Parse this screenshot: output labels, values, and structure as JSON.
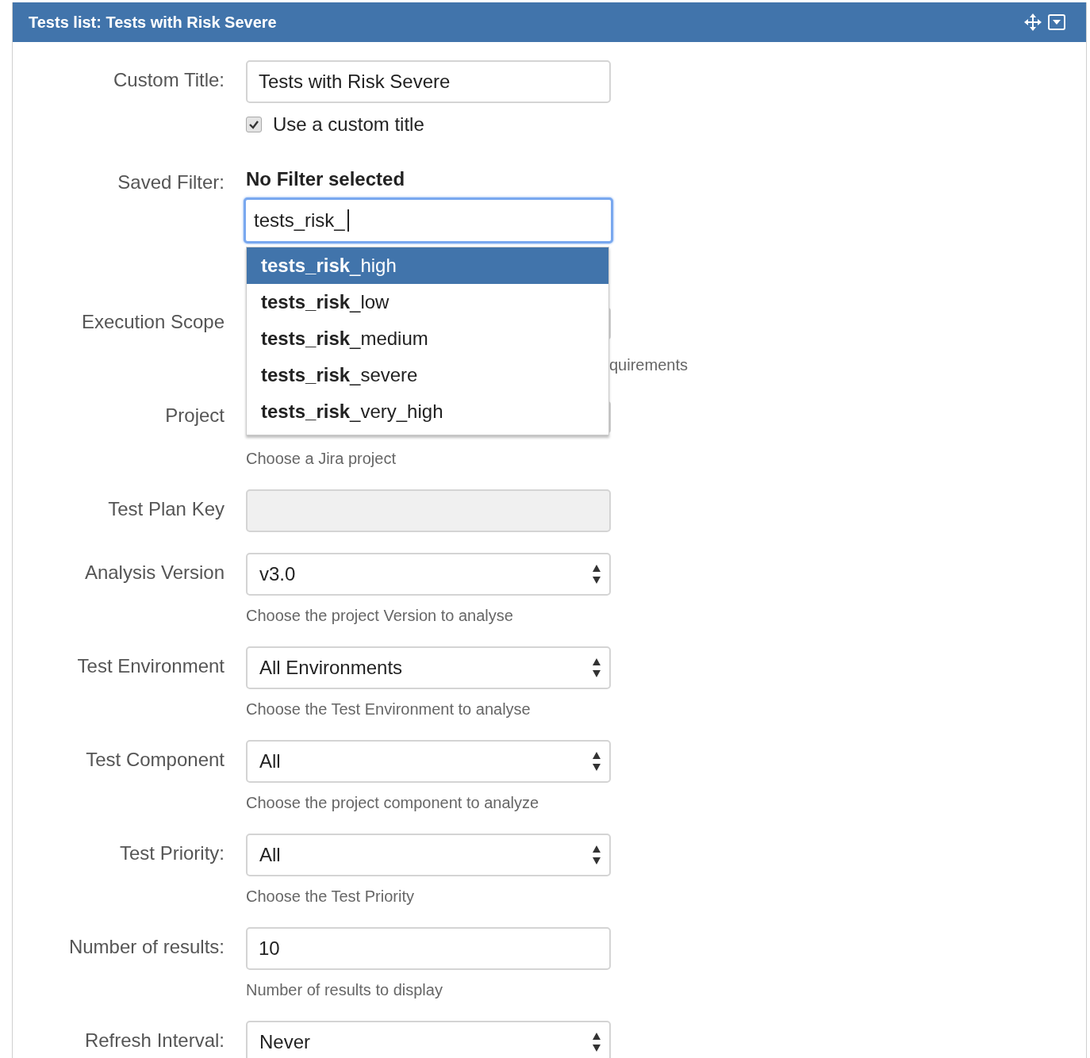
{
  "panel": {
    "title": "Tests list: Tests with Risk Severe"
  },
  "custom_title": {
    "label": "Custom Title:",
    "value": "Tests with Risk Severe",
    "checkbox": {
      "label": "Use a custom title",
      "checked": true
    }
  },
  "saved_filter": {
    "label": "Saved Filter:",
    "selected_text": "No Filter selected",
    "query": "tests_risk_",
    "suggestions": [
      {
        "text": "**tests_risk**_high",
        "selected": true
      },
      {
        "text": "**tests_risk**_low",
        "selected": false
      },
      {
        "text": "**tests_risk**_medium",
        "selected": false
      },
      {
        "text": "**tests_risk**_severe",
        "selected": false
      },
      {
        "text": "**tests_risk**_very_high",
        "selected": false
      }
    ]
  },
  "fields": [
    {
      "label": "Execution Scope",
      "kind": "hidden-select",
      "hint_tail": "quirements"
    },
    {
      "label": "Project",
      "kind": "hidden-select",
      "hint": "Choose a Jira project"
    },
    {
      "label": "Test Plan Key",
      "kind": "disabled-input"
    },
    {
      "label": "Analysis Version",
      "kind": "select",
      "value": "v3.0",
      "hint": "Choose the project Version to analyse"
    },
    {
      "label": "Test Environment",
      "kind": "select",
      "value": "All Environments",
      "hint": "Choose the Test Environment to analyse"
    },
    {
      "label": "Test Component",
      "kind": "select",
      "value": "All",
      "hint": "Choose the project component to analyze"
    },
    {
      "label": "Test Priority:",
      "kind": "select",
      "value": "All",
      "hint": "Choose the Test Priority"
    },
    {
      "label": "Number of results:",
      "kind": "input",
      "value": "10",
      "hint": "Number of results to display"
    },
    {
      "label": "Refresh Interval:",
      "kind": "select",
      "value": "Never"
    }
  ]
}
